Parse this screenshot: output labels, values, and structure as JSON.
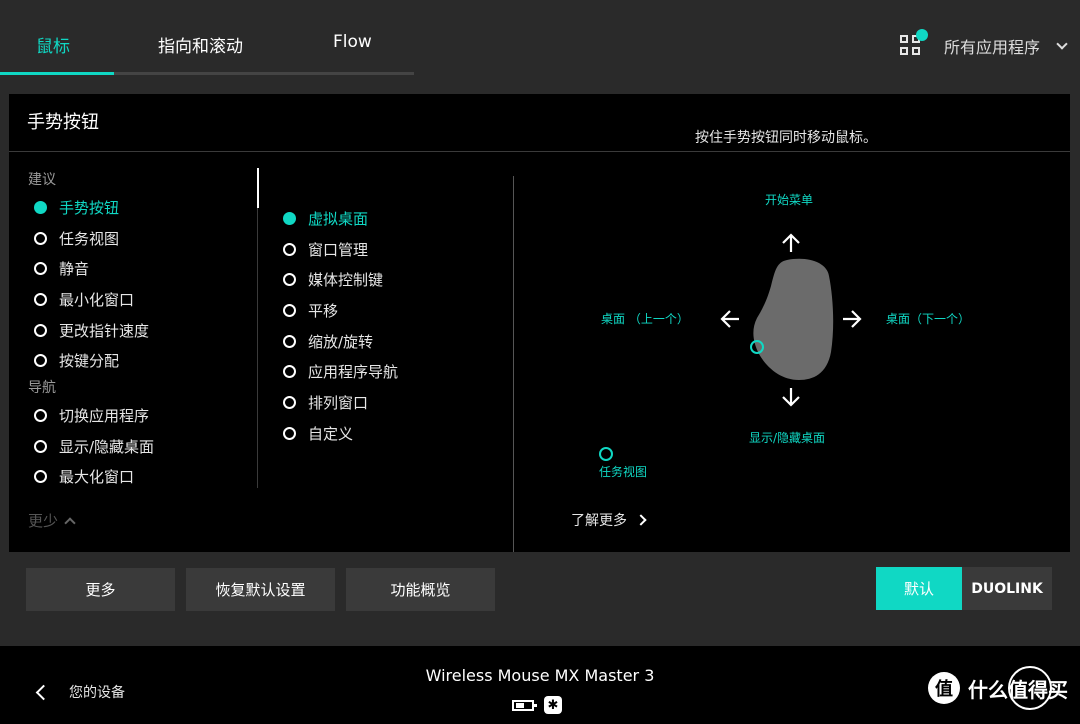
{
  "tabs": [
    {
      "label": "鼠标",
      "active": true
    },
    {
      "label": "指向和滚动",
      "active": false
    },
    {
      "label": "Flow",
      "active": false
    }
  ],
  "apps": {
    "label": "所有应用程序",
    "icon": "apps-grid-icon"
  },
  "panel": {
    "title": "手势按钮",
    "hint": "按住手势按钮同时移动鼠标。",
    "groups": [
      {
        "label": "建议",
        "items": [
          "手势按钮",
          "任务视图",
          "静音",
          "最小化窗口",
          "更改指针速度",
          "按键分配"
        ]
      },
      {
        "label": "导航",
        "items": [
          "切换应用程序",
          "显示/隐藏桌面",
          "最大化窗口"
        ]
      }
    ],
    "less_label": "更少",
    "options": [
      "虚拟桌面",
      "窗口管理",
      "媒体控制键",
      "平移",
      "缩放/旋转",
      "应用程序导航",
      "排列窗口",
      "自定义"
    ],
    "diagram": {
      "up": "开始菜单",
      "left": "桌面 （上一个）",
      "right": "桌面（下一个）",
      "down": "显示/隐藏桌面",
      "click": "任务视图"
    },
    "learn_more": "了解更多"
  },
  "buttons": {
    "more": "更多",
    "restore": "恢复默认设置",
    "overview": "功能概览",
    "default": "默认",
    "duolink": "DUOLINK"
  },
  "footer": {
    "back_label": "您的设备",
    "device_name": "Wireless Mouse MX Master 3",
    "watermark": "什么值得买",
    "watermark_logo": "值"
  },
  "colors": {
    "accent": "#10d8c4",
    "background": "#2a2a2a",
    "panel": "#000000"
  }
}
